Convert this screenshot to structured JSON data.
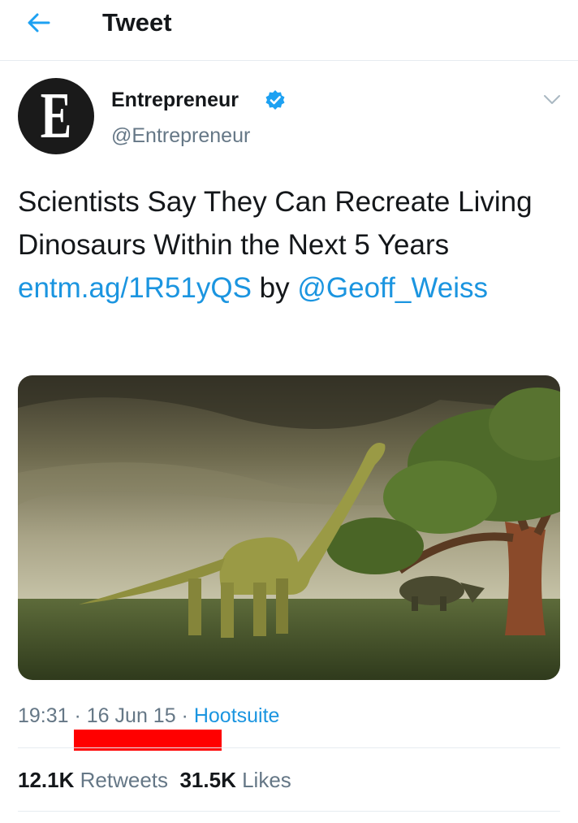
{
  "header": {
    "title": "Tweet",
    "back_icon": "arrow-left-icon"
  },
  "author": {
    "name": "Entrepreneur",
    "handle": "@Entrepreneur",
    "avatar_letter": "E",
    "verified_icon": "verified-badge-icon",
    "menu_icon": "chevron-down-icon"
  },
  "tweet": {
    "text_before": "Scientists Say They Can Recreate Living Dinosaurs Within the Next 5 Years ",
    "link": "entm.ag/1R51yQS",
    "by": " by ",
    "mention": "@Geoff_Weiss"
  },
  "meta": {
    "time": "19:31",
    "sep1": " · ",
    "date": "16 Jun 15",
    "sep2": " · ",
    "source": "Hootsuite"
  },
  "stats": {
    "retweets_count": "12.1K",
    "retweets_label": "Retweets",
    "likes_count": "31.5K",
    "likes_label": "Likes"
  },
  "colors": {
    "accent": "#1b95e0",
    "muted": "#657786",
    "text": "#14171a",
    "redaction": "#ff0000"
  }
}
